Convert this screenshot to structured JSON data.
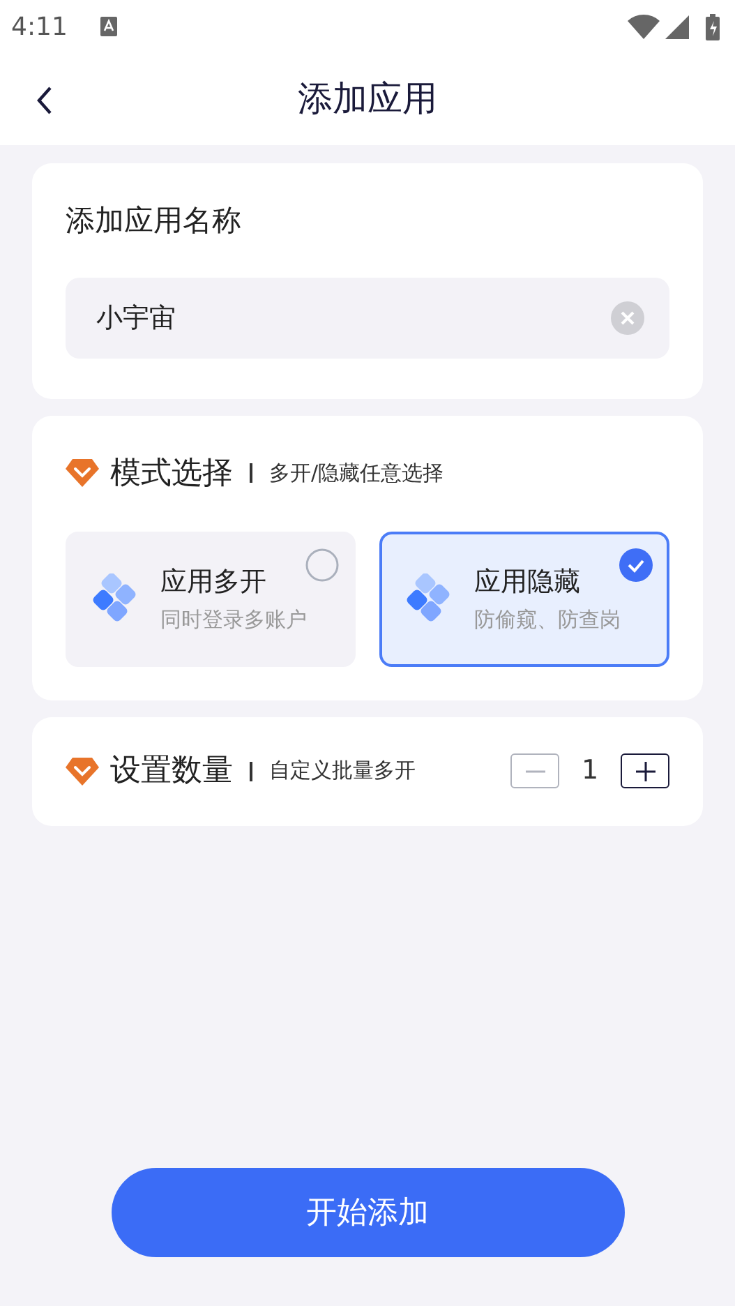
{
  "status_bar": {
    "time": "4:11"
  },
  "header": {
    "title": "添加应用"
  },
  "name_card": {
    "label": "添加应用名称",
    "value": "小宇宙"
  },
  "mode_card": {
    "title": "模式选择",
    "subtitle": "多开/隐藏任意选择",
    "options": [
      {
        "title": "应用多开",
        "description": "同时登录多账户",
        "selected": false
      },
      {
        "title": "应用隐藏",
        "description": "防偷窥、防查岗",
        "selected": true
      }
    ]
  },
  "count_card": {
    "title": "设置数量",
    "subtitle": "自定义批量多开",
    "value": "1",
    "decrement_disabled": true,
    "increment_disabled": false
  },
  "submit": {
    "label": "开始添加"
  }
}
